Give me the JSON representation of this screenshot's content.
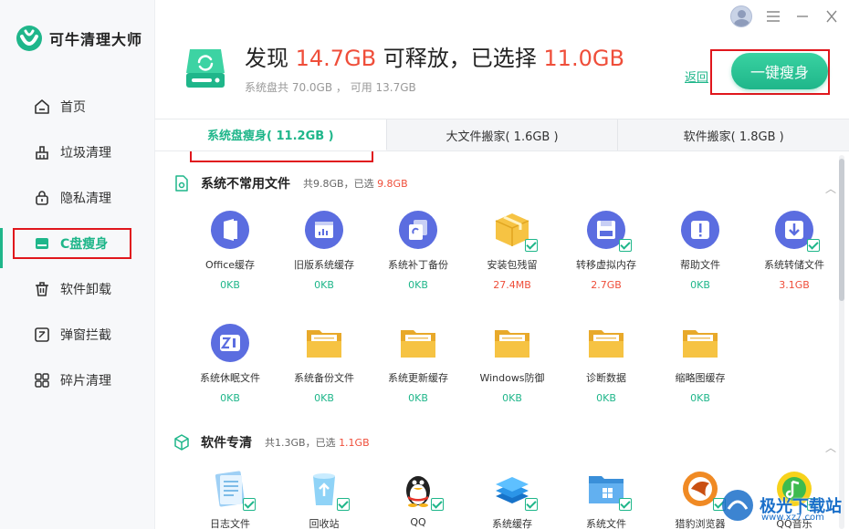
{
  "app": {
    "logo_text": "可牛清理大师"
  },
  "nav": {
    "items": [
      {
        "label": "首页",
        "icon": "home-icon"
      },
      {
        "label": "垃圾清理",
        "icon": "broom-icon"
      },
      {
        "label": "隐私清理",
        "icon": "lock-icon"
      },
      {
        "label": "C盘瘦身",
        "icon": "disk-icon",
        "active": true
      },
      {
        "label": "软件卸载",
        "icon": "trash-icon"
      },
      {
        "label": "弹窗拦截",
        "icon": "popup-block-icon"
      },
      {
        "label": "碎片清理",
        "icon": "grid-icon"
      }
    ]
  },
  "header": {
    "found_prefix": "发现 ",
    "found_value": "14.7GB",
    "found_mid": " 可释放，已选择 ",
    "selected_value": "11.0GB",
    "disk_info": "系统盘共 70.0GB ， 可用 13.7GB",
    "back_label": "返回",
    "slim_button": "一键瘦身"
  },
  "tabs": [
    {
      "label": "系统盘瘦身( 11.2GB )",
      "active": true
    },
    {
      "label": "大文件搬家( 1.6GB )"
    },
    {
      "label": "软件搬家( 1.8GB )"
    }
  ],
  "sections": [
    {
      "title": "系统不常用文件",
      "stat_prefix": "共9.8GB，已选 ",
      "stat_selected": "9.8GB",
      "items": [
        {
          "name": "Office缓存",
          "size": "0KB",
          "icon": "office-icon"
        },
        {
          "name": "旧版系统缓存",
          "size": "0KB",
          "icon": "chart-window-icon"
        },
        {
          "name": "系统补丁备份",
          "size": "0KB",
          "icon": "copy-icon"
        },
        {
          "name": "安装包残留",
          "size": "27.4MB",
          "icon": "package-box-icon",
          "checked": true,
          "red": true
        },
        {
          "name": "转移虚拟内存",
          "size": "2.7GB",
          "icon": "floppy-icon",
          "checked": true,
          "red": true
        },
        {
          "name": "帮助文件",
          "size": "0KB",
          "icon": "alert-icon"
        },
        {
          "name": "系统转储文件",
          "size": "3.1GB",
          "icon": "download-icon",
          "checked": true,
          "red": true
        },
        {
          "name": "系统休眠文件",
          "size": "0KB",
          "icon": "sleep-zz-icon"
        },
        {
          "name": "系统备份文件",
          "size": "0KB",
          "icon": "folder-icon"
        },
        {
          "name": "系统更新缓存",
          "size": "0KB",
          "icon": "folder-icon"
        },
        {
          "name": "Windows防御",
          "size": "0KB",
          "icon": "folder-icon"
        },
        {
          "name": "诊断数据",
          "size": "0KB",
          "icon": "folder-icon"
        },
        {
          "name": "缩略图缓存",
          "size": "0KB",
          "icon": "folder-icon"
        }
      ]
    },
    {
      "title": "软件专清",
      "stat_prefix": "共1.3GB，已选 ",
      "stat_selected": "1.1GB",
      "items": [
        {
          "name": "日志文件",
          "icon": "log-file-icon"
        },
        {
          "name": "回收站",
          "icon": "recycle-bin-icon",
          "checked": true
        },
        {
          "name": "QQ",
          "icon": "qq-penguin-icon",
          "checked": true
        },
        {
          "name": "系统缓存",
          "icon": "layers-icon",
          "checked": true
        },
        {
          "name": "系统文件",
          "icon": "windows-folder-icon",
          "checked": true
        },
        {
          "name": "猎豹浏览器",
          "icon": "cheetah-browser-icon",
          "checked": true
        },
        {
          "name": "QQ音乐",
          "icon": "qq-music-icon",
          "checked": true
        }
      ]
    }
  ],
  "watermark": {
    "text": "极光下载站",
    "sub": "www.xz7.com"
  },
  "colors": {
    "accent": "#1fb68a",
    "red": "#ef4e3a",
    "icon_purple": "#5b6de0",
    "folder_yellow": "#f6c343",
    "highlight": "#e0161c"
  }
}
